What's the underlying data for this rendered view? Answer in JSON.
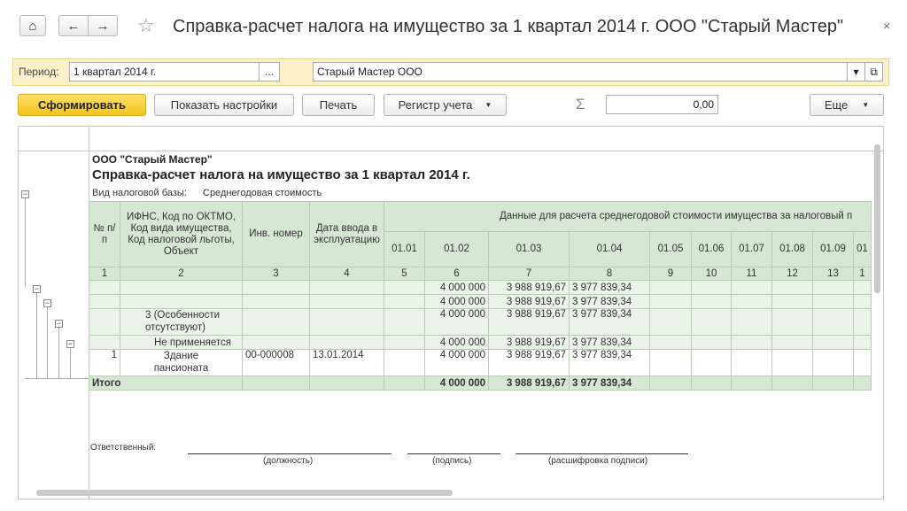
{
  "window": {
    "title": "Справка-расчет налога на имущество за 1 квартал 2014 г. ООО \"Старый Мастер\"",
    "close_glyph": "×"
  },
  "nav": {
    "home_glyph": "⌂",
    "back_glyph": "←",
    "forward_glyph": "→",
    "star_glyph": "☆"
  },
  "filter": {
    "period_label": "Период:",
    "period_value": "1 квартал 2014 г.",
    "period_btn": "...",
    "org_value": "Старый Мастер ООО",
    "dropdown_glyph": "▾",
    "open_glyph": "⧉"
  },
  "toolbar": {
    "generate": "Сформировать",
    "settings": "Показать настройки",
    "print": "Печать",
    "register": "Регистр учета",
    "register_arrow": "▼",
    "sigma": "Σ",
    "sum_value": "0,00",
    "more": "Еще",
    "more_arrow": "▼"
  },
  "report": {
    "org": "ООО \"Старый Мастер\"",
    "heading": "Справка-расчет налога на имущество за 1 квартал 2014 г.",
    "base_label": "Вид налоговой базы:",
    "base_value": "Среднегодовая стоимость",
    "headers": {
      "num": "№ п/п",
      "ifns": "ИФНС, Код по ОКТМО, Код вида имущества, Код налоговой льготы, Объект",
      "inv": "Инв. номер",
      "date": "Дата ввода в эксплуатацию",
      "group": "Данные для расчета среднегодовой стоимости имущества за налоговый п",
      "months": [
        "01.01",
        "01.02",
        "01.03",
        "01.04",
        "01.05",
        "01.06",
        "01.07",
        "01.08",
        "01.09",
        "01"
      ]
    },
    "col_numbers": [
      "1",
      "2",
      "3",
      "4",
      "5",
      "6",
      "7",
      "8",
      "9",
      "10",
      "11",
      "12",
      "13",
      "1"
    ],
    "rows": [
      {
        "c2": "",
        "c3": "",
        "c4": "",
        "v6": "4 000 000",
        "v7": "3 988 919,67",
        "v8": "3 977 839,34"
      },
      {
        "c2": "",
        "c3": "",
        "c4": "",
        "v6": "4 000 000",
        "v7": "3 988 919,67",
        "v8": "3 977 839,34"
      },
      {
        "c2": "3 (Особенности отсутствуют)",
        "c3": "",
        "c4": "",
        "v6": "4 000 000",
        "v7": "3 988 919,67",
        "v8": "3 977 839,34"
      },
      {
        "c2": "Не применяется",
        "c3": "",
        "c4": "",
        "v6": "4 000 000",
        "v7": "3 988 919,67",
        "v8": "3 977 839,34"
      },
      {
        "c1": "1",
        "c2": "Здание пансионата",
        "c3": "00-000008",
        "c4": "13.01.2014",
        "v6": "4 000 000",
        "v7": "3 988 919,67",
        "v8": "3 977 839,34"
      }
    ],
    "total": {
      "label": "Итого",
      "v6": "4 000 000",
      "v7": "3 988 919,67",
      "v8": "3 977 839,34"
    },
    "signature": {
      "responsible": "Ответственный:",
      "position": "(должность)",
      "sign": "(подпись)",
      "decode": "(расшифровка подписи)"
    }
  }
}
